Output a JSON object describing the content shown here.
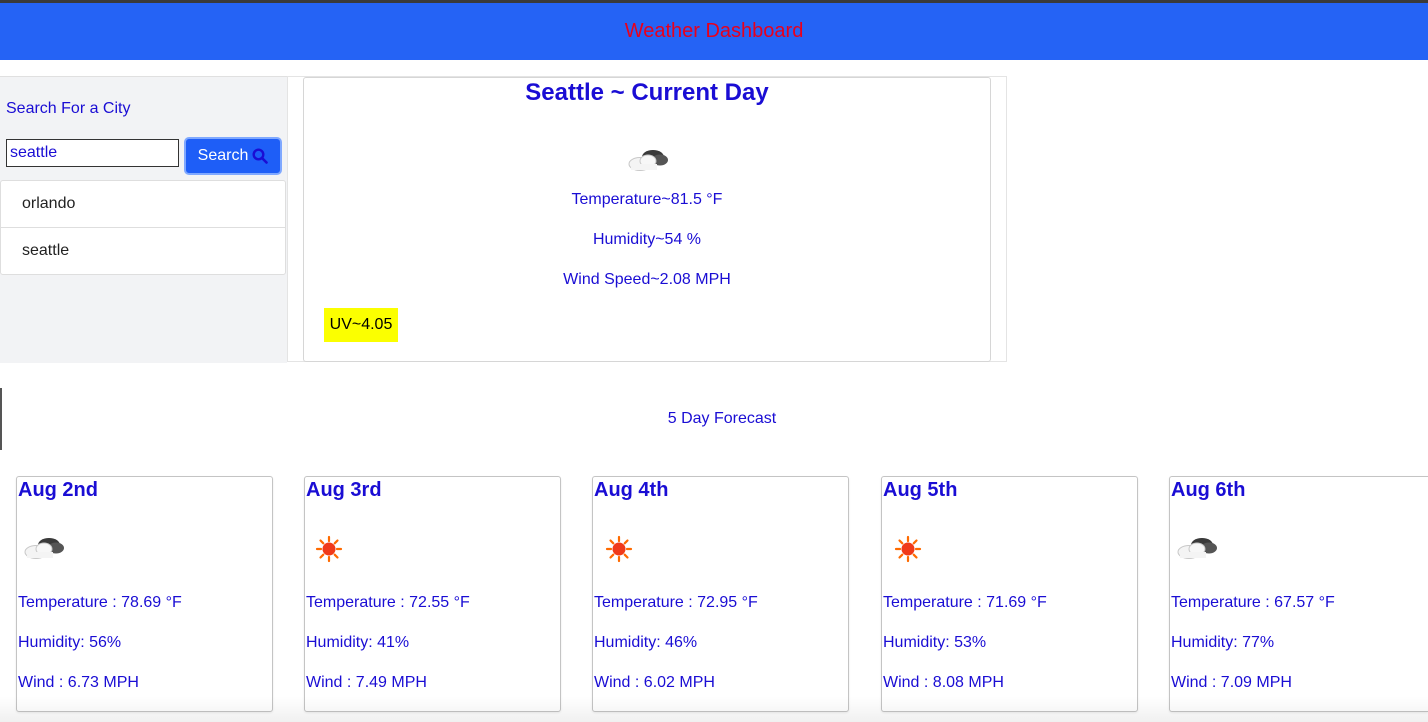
{
  "header": {
    "title": "Weather Dashboard",
    "bg_color": "#2563f5",
    "title_color": "#e8001d"
  },
  "sidebar": {
    "heading": "Search For a City",
    "search_input_value": "seattle",
    "search_button_label": "Search",
    "search_button_icon": "search-icon",
    "history": [
      {
        "label": "orlando"
      },
      {
        "label": "seattle"
      }
    ]
  },
  "current": {
    "title": "Seattle ~ Current Day",
    "icon": "clouds-icon",
    "temperature": "Temperature~81.5 °F",
    "humidity": "Humidity~54 %",
    "wind": "Wind Speed~2.08 MPH",
    "uv": "UV~4.05",
    "uv_color": "#fbff00"
  },
  "forecast": {
    "heading": "5 Day Forecast",
    "days": [
      {
        "date": "Aug 2nd",
        "icon": "clouds-icon",
        "temp": "Temperature : 78.69 °F",
        "humidity": "Humidity: 56%",
        "wind": "Wind : 6.73 MPH"
      },
      {
        "date": "Aug 3rd",
        "icon": "sun-icon",
        "temp": "Temperature : 72.55 °F",
        "humidity": "Humidity: 41%",
        "wind": "Wind : 7.49 MPH"
      },
      {
        "date": "Aug 4th",
        "icon": "sun-icon",
        "temp": "Temperature : 72.95 °F",
        "humidity": "Humidity: 46%",
        "wind": "Wind : 6.02 MPH"
      },
      {
        "date": "Aug 5th",
        "icon": "sun-icon",
        "temp": "Temperature : 71.69 °F",
        "humidity": "Humidity: 53%",
        "wind": "Wind : 8.08 MPH"
      },
      {
        "date": "Aug 6th",
        "icon": "clouds-icon",
        "temp": "Temperature : 67.57 °F",
        "humidity": "Humidity: 77%",
        "wind": "Wind : 7.09 MPH"
      }
    ]
  },
  "text_color": "#1a0dd4"
}
